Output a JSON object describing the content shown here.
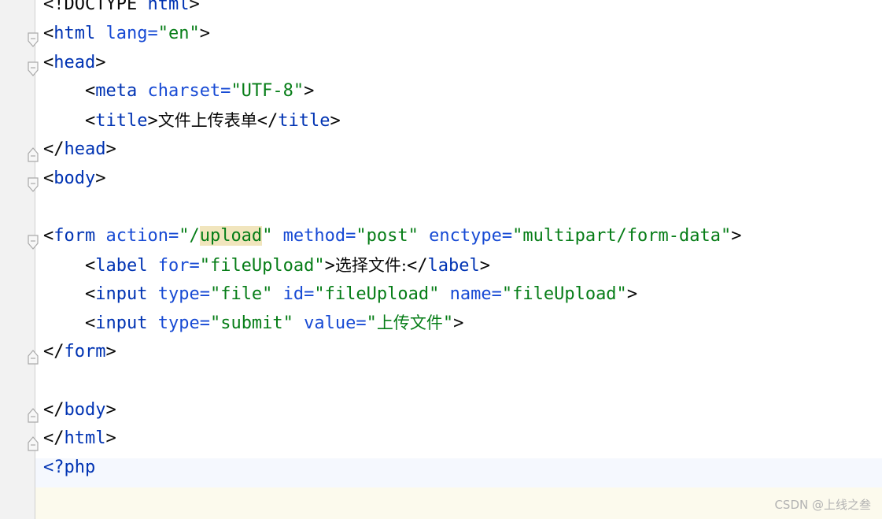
{
  "lines": [
    {
      "parts": [
        "<!DOCTYPE ",
        "html",
        ">"
      ]
    },
    {
      "parts": [
        "<",
        "html",
        " lang=",
        "\"en\"",
        ">"
      ]
    },
    {
      "parts": [
        "<",
        "head",
        ">"
      ]
    },
    {
      "parts": [
        "    <",
        "meta",
        " charset=",
        "\"UTF-8\"",
        ">"
      ]
    },
    {
      "parts": [
        "    <",
        "title",
        ">",
        "文件上传表单",
        "</",
        "title",
        ">"
      ]
    },
    {
      "parts": [
        "</",
        "head",
        ">"
      ]
    },
    {
      "parts": [
        "<",
        "body",
        ">"
      ]
    },
    {
      "parts": []
    },
    {
      "parts": [
        "<",
        "form",
        " action=",
        "\"/",
        "upload",
        "\"",
        " method=",
        "\"post\"",
        " enctype=",
        "\"multipart/form-data\"",
        ">"
      ]
    },
    {
      "parts": [
        "    <",
        "label",
        " for=",
        "\"fileUpload\"",
        ">",
        "选择文件:",
        "</",
        "label",
        ">"
      ]
    },
    {
      "parts": [
        "    <",
        "input",
        " type=",
        "\"file\"",
        " id=",
        "\"fileUpload\"",
        " name=",
        "\"fileUpload\"",
        ">"
      ]
    },
    {
      "parts": [
        "    <",
        "input",
        " type=",
        "\"submit\"",
        " value=",
        "\"",
        "上传文件",
        "\"",
        ">"
      ]
    },
    {
      "parts": [
        "</",
        "form",
        ">"
      ]
    },
    {
      "parts": []
    },
    {
      "parts": [
        "</",
        "body",
        ">"
      ]
    },
    {
      "parts": [
        "</",
        "html",
        ">"
      ]
    },
    {
      "parts": [
        "<?php"
      ]
    },
    {
      "parts": []
    }
  ],
  "watermark": "CSDN @上线之叁",
  "colors": {
    "tag": "#0033b3",
    "attribute": "#174ad4",
    "string": "#067d17",
    "text": "#080808",
    "highlight": "#f1e5bd",
    "gutter": "#f2f2f2"
  },
  "icons": [
    "fold-open-icon",
    "fold-close-icon"
  ]
}
